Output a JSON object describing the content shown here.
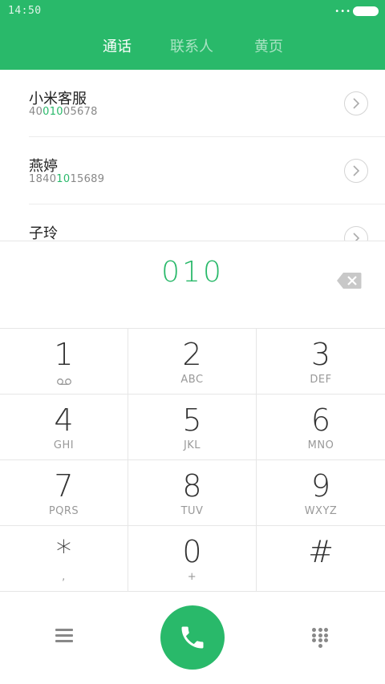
{
  "status_bar": {
    "time": "14:50",
    "signal_dots": "•••"
  },
  "tabs": [
    {
      "label": "通话",
      "active": true
    },
    {
      "label": "联系人",
      "active": false
    },
    {
      "label": "黄页",
      "active": false
    }
  ],
  "contacts": [
    {
      "name": "小米客服",
      "number_pre": "40",
      "number_match": "010",
      "number_post": "05678"
    },
    {
      "name": "燕婷",
      "number_pre": "1840",
      "number_match": "10",
      "number_post": "15689"
    },
    {
      "name": "子玲",
      "number_pre": "",
      "number_match": "",
      "number_post": ""
    }
  ],
  "dialed_number": "010",
  "keypad": [
    {
      "digit": "1",
      "letters": "",
      "icon": "voicemail-icon"
    },
    {
      "digit": "2",
      "letters": "ABC"
    },
    {
      "digit": "3",
      "letters": "DEF"
    },
    {
      "digit": "4",
      "letters": "GHI"
    },
    {
      "digit": "5",
      "letters": "JKL"
    },
    {
      "digit": "6",
      "letters": "MNO"
    },
    {
      "digit": "7",
      "letters": "PQRS"
    },
    {
      "digit": "8",
      "letters": "TUV"
    },
    {
      "digit": "9",
      "letters": "WXYZ"
    },
    {
      "digit": "*",
      "letters": ","
    },
    {
      "digit": "0",
      "letters": "+"
    },
    {
      "digit": "#",
      "letters": ""
    }
  ],
  "colors": {
    "accent": "#29b96a",
    "divider": "#e6e6e6",
    "text": "#333333",
    "subtext": "#999999"
  },
  "icons": {
    "backspace": "backspace-icon",
    "menu": "menu-icon",
    "call": "phone-icon",
    "dialpad": "dialpad-icon",
    "chevron": "chevron-right-icon"
  }
}
